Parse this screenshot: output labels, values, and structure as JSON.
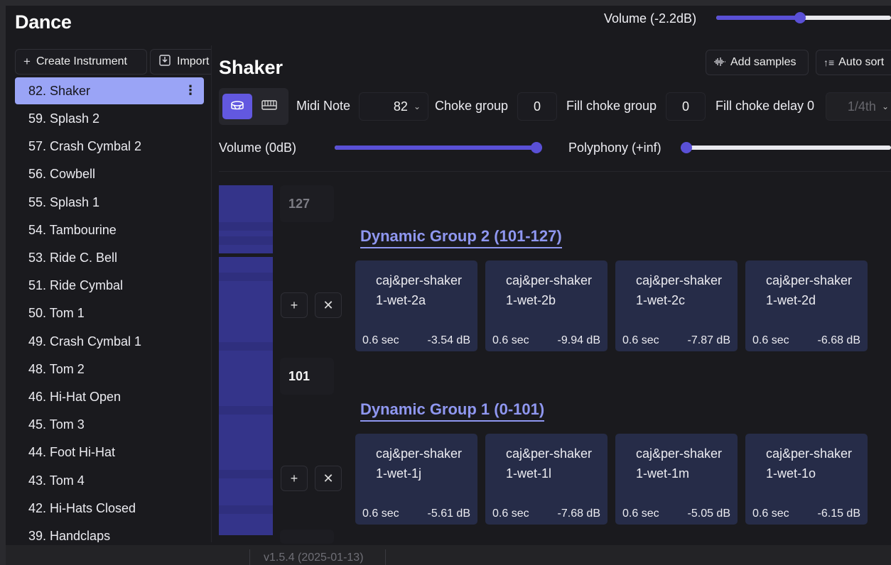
{
  "app": {
    "title": "Dance"
  },
  "master_volume": {
    "label": "Volume (-2.2dB)",
    "level": 0.48
  },
  "sidebar": {
    "create_label": "Create Instrument",
    "import_label": "Import",
    "items": [
      {
        "label": "82. Shaker",
        "selected": true
      },
      {
        "label": "59. Splash 2"
      },
      {
        "label": "57. Crash Cymbal 2"
      },
      {
        "label": "56. Cowbell"
      },
      {
        "label": "55. Splash 1"
      },
      {
        "label": "54. Tambourine"
      },
      {
        "label": "53. Ride C. Bell"
      },
      {
        "label": "51. Ride Cymbal"
      },
      {
        "label": "50. Tom 1"
      },
      {
        "label": "49. Crash Cymbal 1"
      },
      {
        "label": "48. Tom 2"
      },
      {
        "label": "46. Hi-Hat Open"
      },
      {
        "label": "45. Tom 3"
      },
      {
        "label": "44. Foot Hi-Hat"
      },
      {
        "label": "43. Tom 4"
      },
      {
        "label": "42. Hi-Hats Closed"
      },
      {
        "label": "39. Handclaps"
      }
    ]
  },
  "instrument": {
    "title": "Shaker",
    "add_samples_label": "Add samples",
    "auto_sort_label": "Auto sort",
    "midi_note_label": "Midi Note",
    "midi_note_value": "82",
    "choke_group_label": "Choke group",
    "choke_group_value": "0",
    "fill_choke_group_label": "Fill choke group",
    "fill_choke_group_value": "0",
    "fill_choke_delay_label": "Fill choke delay 0",
    "fill_choke_delay_value": "1/4th",
    "volume_label": "Volume (0dB)",
    "volume_level": 1.0,
    "polyphony_label": "Polyphony (+inf)",
    "polyphony_level": 0.0
  },
  "velocity_markers": {
    "top": "127",
    "mid": "101"
  },
  "groups": [
    {
      "title": "Dynamic Group 2 (101-127)",
      "samples": [
        {
          "name": "caj&per-shaker1-wet-2a",
          "duration": "0.6 sec",
          "gain": "-3.54 dB"
        },
        {
          "name": "caj&per-shaker1-wet-2b",
          "duration": "0.6 sec",
          "gain": "-9.94 dB"
        },
        {
          "name": "caj&per-shaker1-wet-2c",
          "duration": "0.6 sec",
          "gain": "-7.87 dB"
        },
        {
          "name": "caj&per-shaker1-wet-2d",
          "duration": "0.6 sec",
          "gain": "-6.68 dB"
        }
      ]
    },
    {
      "title": "Dynamic Group 1 (0-101)",
      "samples": [
        {
          "name": "caj&per-shaker1-wet-1j",
          "duration": "0.6 sec",
          "gain": "-5.61 dB"
        },
        {
          "name": "caj&per-shaker1-wet-1l",
          "duration": "0.6 sec",
          "gain": "-7.68 dB"
        },
        {
          "name": "caj&per-shaker1-wet-1m",
          "duration": "0.6 sec",
          "gain": "-5.05 dB"
        },
        {
          "name": "caj&per-shaker1-wet-1o",
          "duration": "0.6 sec",
          "gain": "-6.15 dB"
        }
      ]
    }
  ],
  "footer": {
    "version": "v1.5.4 (2025-01-13)"
  },
  "colors": {
    "accent": "#5a50d6",
    "selected_item": "#9aa4f6",
    "group_title": "#8f97f0",
    "card_bg": "#262c48"
  },
  "icons": [
    "plus-icon",
    "import-icon",
    "kebab-menu-icon",
    "waveform-icon",
    "sort-icon",
    "drum-icon",
    "keyboard-icon",
    "chevron-down-icon",
    "close-icon"
  ]
}
